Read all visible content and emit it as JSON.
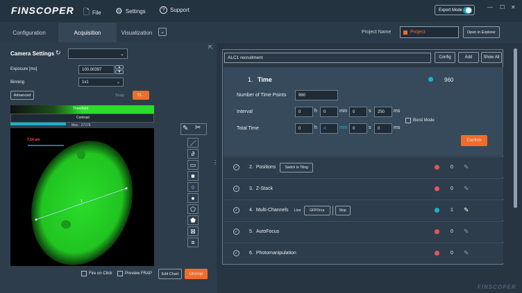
{
  "app": {
    "logo": "FINSCOPER",
    "footer_logo": "FINSCOPER"
  },
  "menu": {
    "file": "File",
    "settings": "Settings",
    "support": "Support"
  },
  "expert_mode": {
    "label": "Expert Mode",
    "on": true
  },
  "tabs": [
    "Configuration",
    "Acquisition",
    "Visualization"
  ],
  "project": {
    "label": "Project Name",
    "value": "Project",
    "open_button": "Open in Explorer"
  },
  "camera": {
    "title": "Camera Settings",
    "exposure_label": "Exposure [ms]",
    "exposure_value": "100.00397",
    "binning_label": "Binning",
    "binning_value": "1x1",
    "advanced": "Advanced",
    "snap": "Snap",
    "start": "St...",
    "threshold": "Threshold",
    "contrast": "Contrast",
    "max": "Max : 27376"
  },
  "image": {
    "scale_label": "7.54 µm",
    "point_label": "1"
  },
  "image_controls": {
    "fire_on_click": "Fire on Click",
    "preview_frap": "Preview FRAP",
    "edit_chart": "Edit Chart",
    "uncrop": "Uncrop"
  },
  "experiment": {
    "name": "ALC1 recruitment",
    "config": "Config",
    "add": "Add",
    "show_all": "Show All"
  },
  "time": {
    "index": "1.",
    "title": "Time",
    "count": "960",
    "tp_label": "Number of Time Points",
    "tp_value": "960",
    "interval_label": "Interval",
    "total_label": "Total Time",
    "burst": "Burst Mode",
    "confirm": "Confirm",
    "interval": {
      "h": "0",
      "min": "0",
      "s": "0",
      "ms": "250"
    },
    "total": {
      "h": "0",
      "min": "4",
      "s": "0",
      "ms": "0"
    },
    "units": {
      "h": "h",
      "min": "min",
      "s": "s",
      "ms": "ms"
    }
  },
  "steps": [
    {
      "index": "2.",
      "title": "Positions",
      "count": "0",
      "status": "#e0575f",
      "extra": "Switch to Tiling"
    },
    {
      "index": "3.",
      "title": "Z-Stack",
      "count": "0",
      "status": "#e0575f"
    },
    {
      "index": "4.",
      "title": "Multi-Channels",
      "count": "1",
      "status": "#17b3cf",
      "live": "Live",
      "channel": "GFPOrca",
      "stop": "Stop"
    },
    {
      "index": "5.",
      "title": "AutoFocus",
      "count": "0",
      "status": "#e0575f"
    },
    {
      "index": "6.",
      "title": "Photomanipulation",
      "count": "0",
      "status": "#e0575f"
    }
  ],
  "colors": {
    "accent": "#f26b2b",
    "teal": "#17b3cf",
    "red": "#e0575f",
    "green": "#2bdc2b"
  }
}
